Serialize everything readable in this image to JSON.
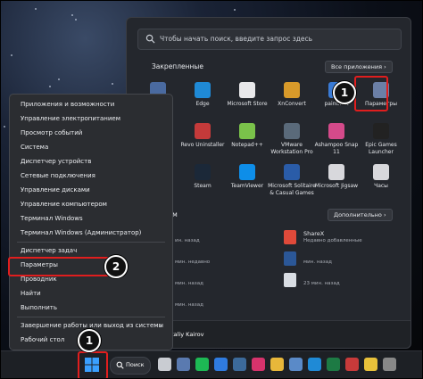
{
  "start_menu": {
    "search_placeholder": "Чтобы начать поиск, введите запрос здесь",
    "pinned_title": "Закрепленные",
    "all_apps_label": "Все приложения",
    "recommended_title_visible": "ндуем",
    "more_label": "Дополнительно",
    "pinned": [
      {
        "name": "",
        "icon": "calculator-icon",
        "color": "#4a6aa0"
      },
      {
        "name": "Edge",
        "icon": "edge-icon",
        "color": "#1f8ad6"
      },
      {
        "name": "Microsoft Store",
        "icon": "store-icon",
        "color": "#e8e8ea"
      },
      {
        "name": "XnConvert",
        "icon": "xnconvert-icon",
        "color": "#d89a2a"
      },
      {
        "name": "paint.net",
        "icon": "paintnet-icon",
        "color": "#3a7bd5"
      },
      {
        "name": "Параметры",
        "icon": "settings-gear-icon",
        "color": "#6b7fa6"
      },
      {
        "name": "",
        "icon": "app-icon",
        "color": "#3a3f48"
      },
      {
        "name": "Revo Uninstaller",
        "icon": "revo-icon",
        "color": "#c43a3a"
      },
      {
        "name": "Notepad++",
        "icon": "notepadpp-icon",
        "color": "#7ac24a"
      },
      {
        "name": "VMware Workstation Pro",
        "icon": "vmware-icon",
        "color": "#5a6a7a"
      },
      {
        "name": "Ashampoo Snap 11",
        "icon": "ashampoo-icon",
        "color": "#d44a8a"
      },
      {
        "name": "Epic Games Launcher",
        "icon": "epic-icon",
        "color": "#222"
      },
      {
        "name": "",
        "icon": "app-icon",
        "color": "#3a3f48"
      },
      {
        "name": "Steam",
        "icon": "steam-icon",
        "color": "#1b2838"
      },
      {
        "name": "TeamViewer",
        "icon": "teamviewer-icon",
        "color": "#0e8ee9"
      },
      {
        "name": "Microsoft Solitaire & Casual Games",
        "icon": "solitaire-icon",
        "color": "#2a5ca8"
      },
      {
        "name": "Microsoft Jigsaw",
        "icon": "jigsaw-icon",
        "color": "#d8d8dc"
      },
      {
        "name": "Часы",
        "icon": "clock-icon",
        "color": "#d8d8dc"
      }
    ],
    "recommended": [
      {
        "name": "",
        "time": "ин. назад",
        "icon": "file-icon",
        "color": "#2d5fb0"
      },
      {
        "name": "",
        "time": "мин. недавно",
        "icon": "file-icon",
        "color": "#3a3f48"
      },
      {
        "name": "ShareX",
        "time": "Недавно добавленные",
        "icon": "sharex-icon",
        "color": "#e04a3a"
      },
      {
        "name": "",
        "time": "мин. назад",
        "icon": "file-icon",
        "color": "#3a3f48"
      },
      {
        "name": "",
        "time": "мин. назад",
        "icon": "word-file-icon",
        "color": "#2b5797"
      },
      {
        "name": "",
        "time": "мин. назад",
        "icon": "file-icon",
        "color": "#3a3f48"
      },
      {
        "name": "",
        "time": "23 мин. назад",
        "icon": "doc-file-icon",
        "color": "#d9dde3"
      }
    ],
    "user_name": "Vitaliy Kairov"
  },
  "context_menu": {
    "items": [
      {
        "label": "Приложения и возможности",
        "submenu": false
      },
      {
        "label": "Управление электропитанием",
        "submenu": false
      },
      {
        "label": "Просмотр событий",
        "submenu": false
      },
      {
        "label": "Система",
        "submenu": false
      },
      {
        "label": "Диспетчер устройств",
        "submenu": false
      },
      {
        "label": "Сетевые подключения",
        "submenu": false
      },
      {
        "label": "Управление дисками",
        "submenu": false
      },
      {
        "label": "Управление компьютером",
        "submenu": false
      },
      {
        "label": "Терминал Windows",
        "submenu": false
      },
      {
        "label": "Терминал Windows (Администратор)",
        "submenu": false
      },
      {
        "label": "Диспетчер задач",
        "submenu": false
      },
      {
        "label": "Параметры",
        "submenu": false
      },
      {
        "label": "Проводник",
        "submenu": false
      },
      {
        "label": "Найти",
        "submenu": false
      },
      {
        "label": "Выполнить",
        "submenu": false
      },
      {
        "label": "Завершение работы или выход из системы",
        "submenu": true
      },
      {
        "label": "Рабочий стол",
        "submenu": false
      }
    ],
    "submenu_arrow": "›"
  },
  "annotations": {
    "step1": "1",
    "step2": "2",
    "step1_taskbar": "1",
    "highlight_color": "#e01e1e"
  },
  "taskbar": {
    "search_label": "Поиск",
    "apps": [
      {
        "icon": "task-view-icon",
        "color": "#c9ccd2"
      },
      {
        "icon": "calculator-icon",
        "color": "#5a7ab0"
      },
      {
        "icon": "spotify-icon",
        "color": "#1db954"
      },
      {
        "icon": "paint-icon",
        "color": "#2f7be0"
      },
      {
        "icon": "steam-icon",
        "color": "#3c6a9a"
      },
      {
        "icon": "instagram-icon",
        "color": "#d6336c"
      },
      {
        "icon": "folder-icon",
        "color": "#e8b73a"
      },
      {
        "icon": "app-icon",
        "color": "#5a8ac8"
      },
      {
        "icon": "edge-icon",
        "color": "#1f8ad6"
      },
      {
        "icon": "excel-icon",
        "color": "#1d7a44"
      },
      {
        "icon": "app-icon",
        "color": "#c83a3a"
      },
      {
        "icon": "chrome-icon",
        "color": "#e8c13a"
      },
      {
        "icon": "app-icon",
        "color": "#888"
      }
    ]
  }
}
